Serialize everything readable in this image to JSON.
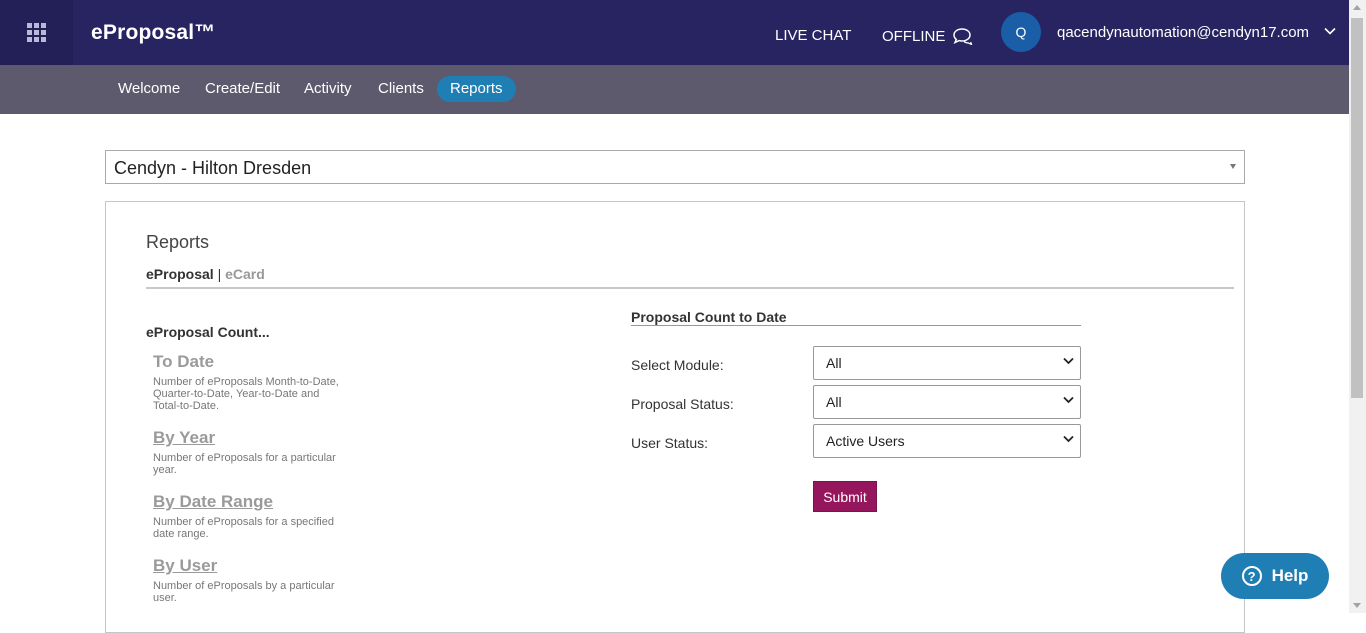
{
  "header": {
    "brand": "eProposal™",
    "live_chat": "LIVE CHAT",
    "offline": "OFFLINE",
    "avatar_initial": "Q",
    "email": "qacendynautomation@cendyn17.com"
  },
  "nav": {
    "items": [
      {
        "label": "Welcome"
      },
      {
        "label": "Create/Edit"
      },
      {
        "label": "Activity"
      },
      {
        "label": "Clients"
      },
      {
        "label": "Reports",
        "active": true
      }
    ]
  },
  "property_select": {
    "value": "Cendyn - Hilton Dresden"
  },
  "reports": {
    "title": "Reports",
    "tab_active": "eProposal",
    "tab_separator": "|",
    "tab_inactive": "eCard",
    "count_heading": "eProposal Count...",
    "links": [
      {
        "label": "To Date",
        "desc": "Number of eProposals Month-to-Date, Quarter-to-Date, Year-to-Date and Total-to-Date."
      },
      {
        "label": "By Year",
        "desc": "Number of eProposals for a particular year."
      },
      {
        "label": "By Date Range",
        "desc": "Number of eProposals for a specified date range."
      },
      {
        "label": "By User",
        "desc": "Number of eProposals by a particular user."
      }
    ]
  },
  "form": {
    "title": "Proposal Count to Date",
    "fields": [
      {
        "label": "Select Module:",
        "value": "All"
      },
      {
        "label": "Proposal Status:",
        "value": "All"
      },
      {
        "label": "User Status:",
        "value": "Active Users"
      }
    ],
    "submit_label": "Submit"
  },
  "help": {
    "label": "Help"
  },
  "colors": {
    "topbar": "#282461",
    "subnav": "#5c5a6c",
    "active_tab": "#1f7fb4",
    "submit": "#96165e",
    "help": "#1f7fb4"
  },
  "icons": [
    "apps-grid-icon",
    "chat-bubble-icon",
    "chevron-down-icon",
    "question-icon"
  ]
}
